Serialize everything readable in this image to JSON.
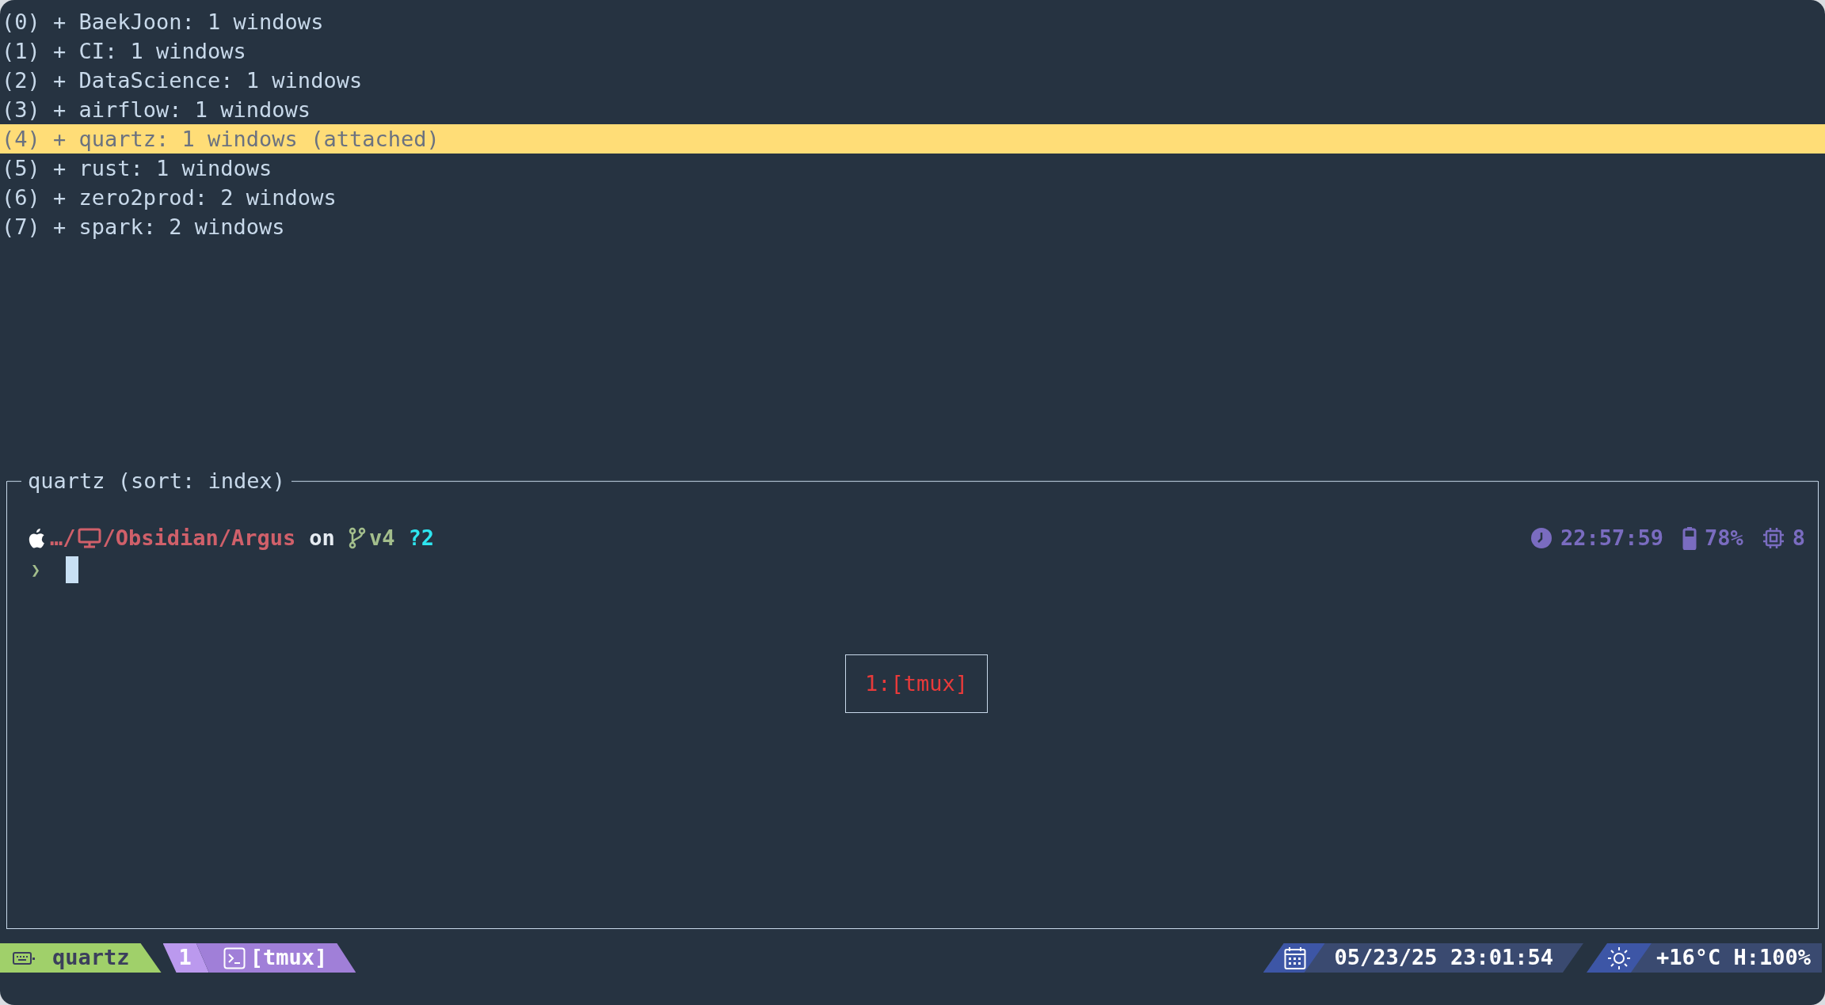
{
  "sessions": [
    {
      "label": "(0) + BaekJoon: 1 windows",
      "selected": false
    },
    {
      "label": "(1) + CI: 1 windows",
      "selected": false
    },
    {
      "label": "(2) + DataScience: 1 windows",
      "selected": false
    },
    {
      "label": "(3) + airflow: 1 windows",
      "selected": false
    },
    {
      "label": "(4) + quartz: 1 windows (attached)",
      "selected": true
    },
    {
      "label": "(5) + rust: 1 windows",
      "selected": false
    },
    {
      "label": "(6) + zero2prod: 2 windows",
      "selected": false
    },
    {
      "label": "(7) + spark: 2 windows",
      "selected": false
    }
  ],
  "preview": {
    "title": "quartz (sort: index)",
    "prompt": {
      "path_prefix": "…/",
      "path": "/Obsidian/Argus",
      "on": "on",
      "branch": "v4",
      "git_status": "?2",
      "symbol": "❯"
    },
    "right_prompt": {
      "time": "22:57:59",
      "battery": "78%",
      "cpus": "8"
    },
    "window_label": "1:[tmux]"
  },
  "status_bar": {
    "session": "quartz",
    "windows": [
      {
        "index": "1",
        "name": "[tmux]",
        "selected": true
      }
    ],
    "datetime": "05/23/25 23:01:54",
    "weather": "+16°C H:100%"
  }
}
